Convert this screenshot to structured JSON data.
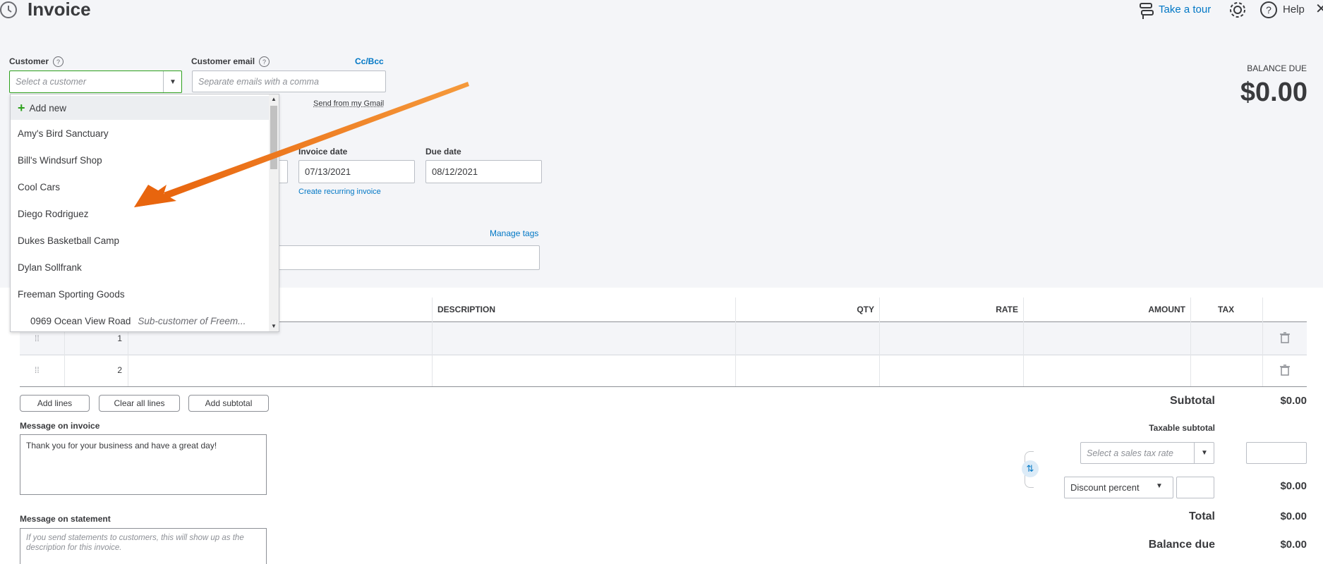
{
  "header": {
    "title": "Invoice",
    "take_tour": "Take a tour",
    "help": "Help"
  },
  "customer": {
    "label": "Customer",
    "placeholder": "Select a customer"
  },
  "email": {
    "label": "Customer email",
    "placeholder": "Separate emails with a comma",
    "cc_bcc": "Cc/Bcc",
    "send_gmail": "Send from my Gmail"
  },
  "balance": {
    "label": "BALANCE DUE",
    "amount": "$0.00"
  },
  "dropdown": {
    "add_new": "Add new",
    "items": [
      "Amy's Bird Sanctuary",
      "Bill's Windsurf Shop",
      "Cool Cars",
      "Diego Rodriguez",
      "Dukes Basketball Camp",
      "Dylan Sollfrank",
      "Freeman Sporting Goods"
    ],
    "sub_item": {
      "name": "0969 Ocean View Road",
      "note": "Sub-customer of Freem..."
    }
  },
  "dates": {
    "invoice_date_label": "Invoice date",
    "invoice_date": "07/13/2021",
    "due_date_label": "Due date",
    "due_date": "08/12/2021",
    "recurring": "Create recurring invoice"
  },
  "tags": {
    "manage": "Manage tags"
  },
  "table": {
    "headers": {
      "description": "DESCRIPTION",
      "qty": "QTY",
      "rate": "RATE",
      "amount": "AMOUNT",
      "tax": "TAX"
    },
    "rows": [
      "1",
      "2"
    ]
  },
  "buttons": {
    "add_lines": "Add lines",
    "clear_all": "Clear all lines",
    "add_subtotal": "Add subtotal"
  },
  "message_invoice": {
    "label": "Message on invoice",
    "value": "Thank you for your business and have a great day!"
  },
  "message_statement": {
    "label": "Message on statement",
    "placeholder": "If you send statements to customers, this will show up as the description for this invoice."
  },
  "totals": {
    "subtotal_label": "Subtotal",
    "subtotal": "$0.00",
    "taxable_label": "Taxable subtotal",
    "tax_rate_placeholder": "Select a sales tax rate",
    "discount_type": "Discount percent",
    "discount_value": "$0.00",
    "total_label": "Total",
    "total": "$0.00",
    "balance_due_label": "Balance due",
    "balance_due": "$0.00"
  },
  "colors": {
    "accent_link": "#0077c5",
    "focus_green": "#2ca01c",
    "annotation_arrow": "#f07a1a"
  }
}
